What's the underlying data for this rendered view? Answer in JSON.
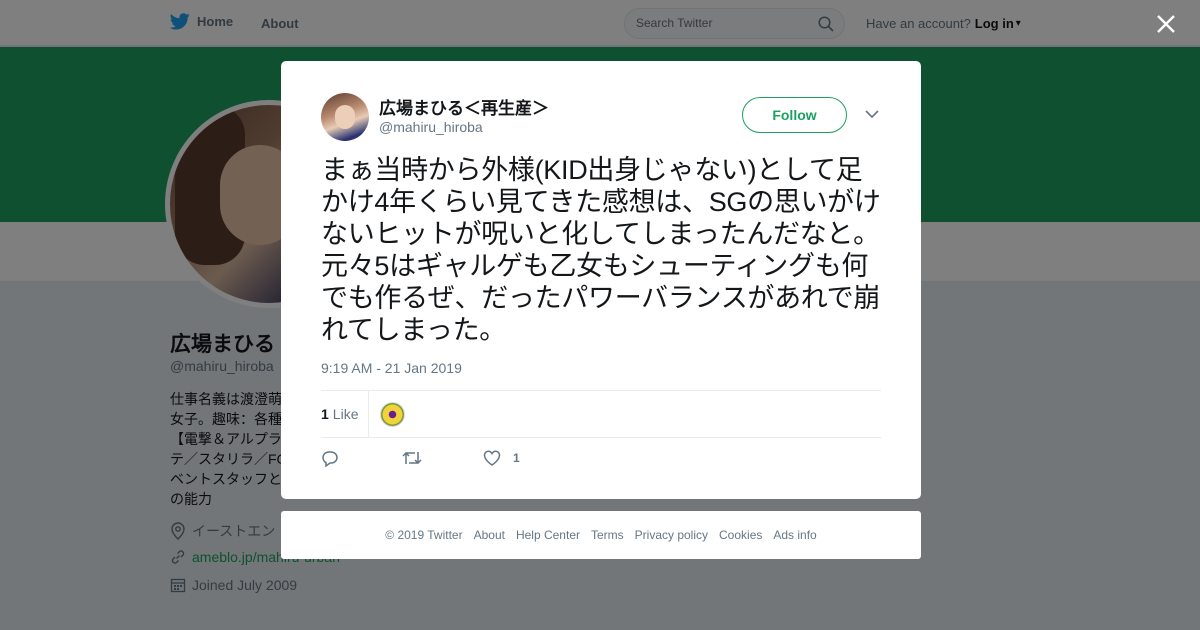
{
  "nav": {
    "home_label": "Home",
    "about_label": "About",
    "search_placeholder": "Search Twitter",
    "have_account": "Have an account?",
    "login_label": "Log in",
    "caret": "▾"
  },
  "profile": {
    "name": "広場まひる",
    "handle": "@mahiru_hiroba",
    "bio": "仕事名義は渡澄萌\n女子。趣味：各種\n【電撃＆アルプラ\nテ／スタリラ／FG\nベントスタッフと\nの能力",
    "location": "イーストエン",
    "website": "ameblo.jp/mahiru-urban",
    "joined": "Joined July 2009"
  },
  "tweet": {
    "name": "広場まひる＜再生産＞",
    "handle": "@mahiru_hiroba",
    "follow_label": "Follow",
    "text": "まぁ当時から外様(KID出身じゃない)として足かけ4年くらい見てきた感想は、SGの思いがけないヒットが呪いと化してしまったんだなと。元々5はギャルゲも乙女もシューティングも何でも作るぜ、だったパワーバランスがあれで崩れてしまった。",
    "timestamp": "9:19 AM - 21 Jan 2019",
    "like_count": "1",
    "like_label": "Like",
    "action_like_count": "1"
  },
  "footer": {
    "links": [
      "© 2019 Twitter",
      "About",
      "Help Center",
      "Terms",
      "Privacy policy",
      "Cookies",
      "Ads info"
    ]
  },
  "colors": {
    "accent": "#1da160",
    "banner": "#1da160",
    "text_secondary": "#657786"
  }
}
